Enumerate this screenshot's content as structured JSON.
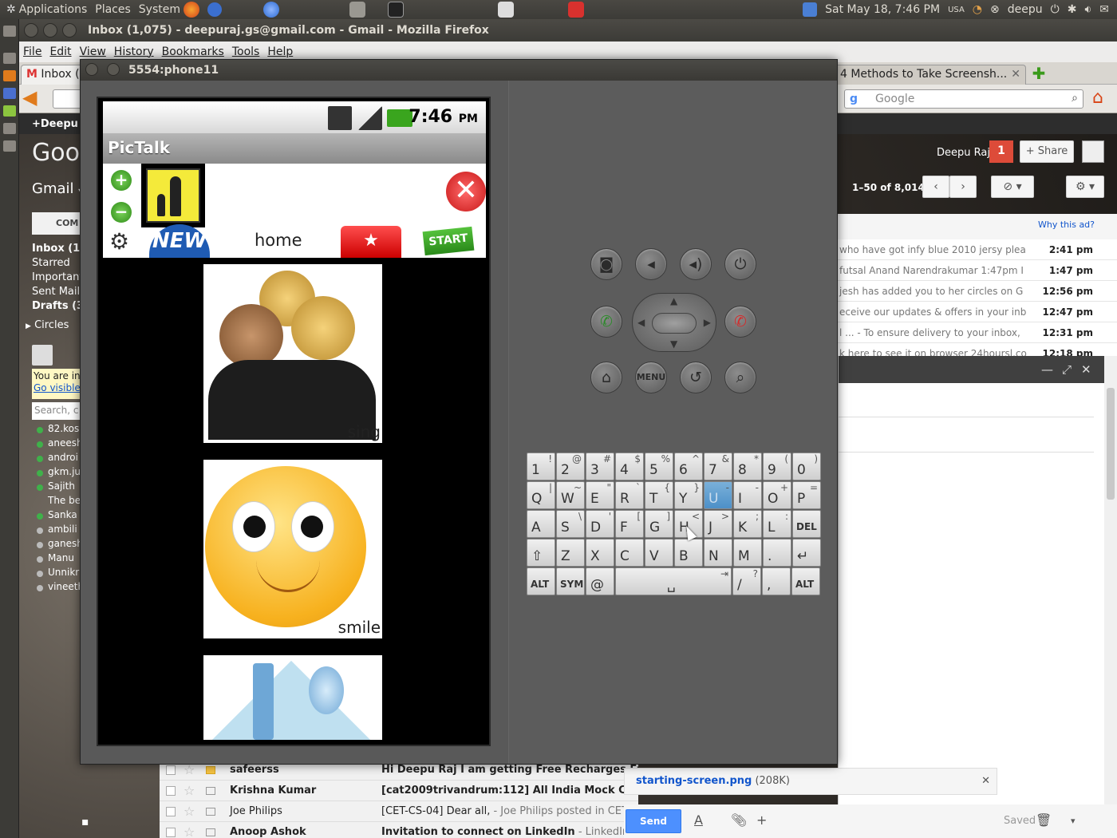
{
  "panel": {
    "menus": [
      "Applications",
      "Places",
      "System"
    ],
    "datetime": "Sat May 18,  7:46 PM",
    "keyboard_layout": "USA",
    "user": "deepu"
  },
  "firefox": {
    "window_title": "Inbox (1,075) - deepuraj.gs@gmail.com - Gmail - Mozilla Firefox",
    "menu": [
      "File",
      "Edit",
      "View",
      "History",
      "Bookmarks",
      "Tools",
      "Help"
    ],
    "tabs": [
      {
        "label": "Inbox (1"
      },
      {
        "label": "4 Methods to Take Screensh..."
      }
    ],
    "search_placeholder": "Google"
  },
  "gmail": {
    "topbar_user": "+Deepu",
    "logo": "Goog",
    "title": "Gmail",
    "compose": "COM",
    "labels": [
      "Inbox (1,0",
      "Starred",
      "Important",
      "Sent Mail",
      "Drafts (30"
    ],
    "circles": "Circles",
    "invisible_notice": "You are in",
    "invisible_link": "Go visible",
    "search_people": "Search, c",
    "chat": [
      {
        "name": "82.kos",
        "color": "#3fb14a"
      },
      {
        "name": "aneesh",
        "color": "#3fb14a"
      },
      {
        "name": "androi",
        "color": "#3fb14a"
      },
      {
        "name": "gkm.ju",
        "color": "#3fb14a"
      },
      {
        "name": "Sajith",
        "color": "#3fb14a"
      },
      {
        "name": "The be",
        "color": "transparent"
      },
      {
        "name": "Sanka",
        "color": "#3fb14a"
      },
      {
        "name": "ambili",
        "color": "#bbbbbb"
      },
      {
        "name": "ganesh",
        "color": "#bbbbbb"
      },
      {
        "name": "Manu",
        "color": "#bbbbbb"
      },
      {
        "name": "Unnikr",
        "color": "#bbbbbb"
      },
      {
        "name": "vineeth",
        "color": "#bbbbbb"
      }
    ],
    "user_name": "Deepu Raj",
    "notification_count": "1",
    "share": "+ Share",
    "pager_range": "1–50 of 8,014",
    "ad_link": "Why this ad?",
    "mails": [
      {
        "snippet": "who have got infy blue 2010 jersy plea",
        "time": "2:41 pm"
      },
      {
        "snippet": "futsal Anand Narendrakumar 1:47pm I",
        "time": "1:47 pm"
      },
      {
        "snippet": "jesh has added you to her circles on G",
        "time": "12:56 pm"
      },
      {
        "snippet": "eceive our updates & offers in your inb",
        "time": "12:47 pm"
      },
      {
        "snippet": "l ... - To ensure delivery to your inbox,",
        "time": "12:31 pm"
      },
      {
        "snippet": "k here to see it on browser 24hoursl.co",
        "time": "12:18 pm"
      }
    ],
    "bottom_list": [
      {
        "from": "safeerss",
        "subject": "Hi Deepu Raj I am getting Free Recharges Every",
        "snippet": ""
      },
      {
        "from": "Krishna Kumar",
        "subject": "[cat2009trivandrum:112] All India Mock CATs fror",
        "snippet": ""
      },
      {
        "from": "Joe Philips",
        "subject": "[CET-CS-04] Dear all,",
        "snippet": " - Joe Philips posted in CET-C"
      },
      {
        "from": "Anoop Ashok",
        "subject": "Invitation to connect on LinkedIn",
        "snippet": " - LinkedIn Logo"
      }
    ],
    "attachment_name": "starting-screen.png",
    "attachment_size": "(208K)",
    "send": "Send",
    "saved": "Saved"
  },
  "emulator": {
    "title": "5554:phone11",
    "clock": "7:46",
    "clock_suffix": "PM",
    "app_title": "PicTalk",
    "new_badge": "NEW",
    "home_label": "home",
    "start_label": "START",
    "cards": [
      {
        "label": "sing"
      },
      {
        "label": "smile"
      },
      {
        "label": ""
      }
    ],
    "menu_label": "MENU",
    "keyboard": {
      "row1": [
        [
          "1",
          "!"
        ],
        [
          "2",
          "@"
        ],
        [
          "3",
          "#"
        ],
        [
          "4",
          "$"
        ],
        [
          "5",
          "%"
        ],
        [
          "6",
          "^"
        ],
        [
          "7",
          "&"
        ],
        [
          "8",
          "*"
        ],
        [
          "9",
          "("
        ],
        [
          "0",
          ")"
        ]
      ],
      "row2": [
        [
          "Q",
          "|"
        ],
        [
          "W",
          "~"
        ],
        [
          "E",
          "\""
        ],
        [
          "R",
          "`"
        ],
        [
          "T",
          "{"
        ],
        [
          "Y",
          "}"
        ],
        [
          "U",
          "-"
        ],
        [
          "I",
          "-"
        ],
        [
          "O",
          "+"
        ],
        [
          "P",
          "="
        ]
      ],
      "row3": [
        [
          "A",
          ""
        ],
        [
          "S",
          "\\"
        ],
        [
          "D",
          "'"
        ],
        [
          "F",
          "["
        ],
        [
          "G",
          "]"
        ],
        [
          "H",
          "<"
        ],
        [
          "J",
          ">"
        ],
        [
          "K",
          ";"
        ],
        [
          "L",
          ":"
        ],
        [
          "DEL",
          ""
        ]
      ],
      "row4": [
        [
          "⇧",
          ""
        ],
        [
          "Z",
          ""
        ],
        [
          "X",
          ""
        ],
        [
          "C",
          ""
        ],
        [
          "V",
          ""
        ],
        [
          "B",
          ""
        ],
        [
          "N",
          ""
        ],
        [
          "M",
          ""
        ],
        [
          ".",
          ""
        ],
        [
          "↵",
          ""
        ]
      ],
      "row5_alt": "ALT",
      "row5_sym": "SYM",
      "row5_at": "@",
      "row5_space": "␣",
      "row5_slash": "/",
      "row5_q": "?",
      "row5_comma": ","
    }
  }
}
